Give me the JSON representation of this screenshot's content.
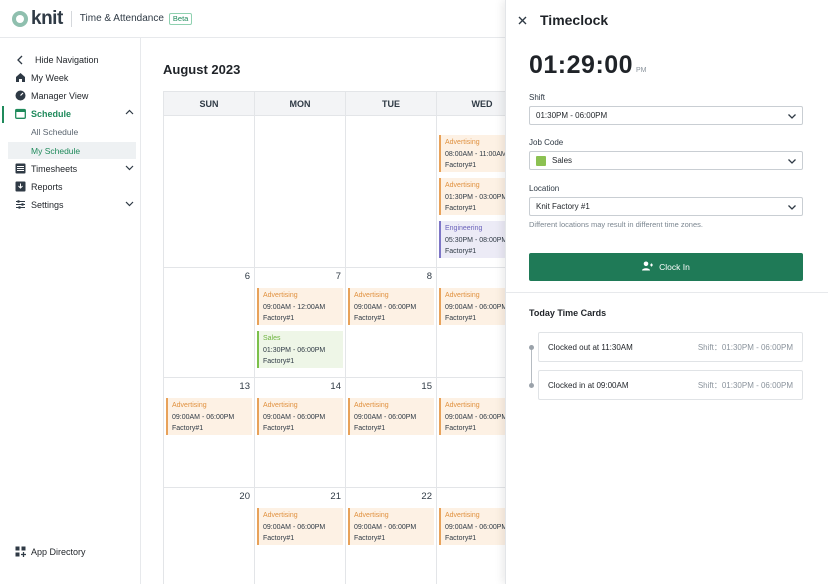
{
  "topbar": {
    "logo_text": "knit",
    "app_name": "Time & Attendance",
    "beta": "Beta"
  },
  "sidebar": {
    "hide_nav": "Hide Navigation",
    "my_week": "My Week",
    "manager_view": "Manager View",
    "schedule": "Schedule",
    "all_schedule": "All Schedule",
    "my_schedule": "My Schedule",
    "timesheets": "Timesheets",
    "reports": "Reports",
    "settings": "Settings",
    "app_directory": "App Directory"
  },
  "calendar": {
    "month": "August 2023",
    "days": [
      "SUN",
      "MON",
      "TUE",
      "WED"
    ],
    "weeks": [
      {
        "nums": [
          "",
          "",
          "",
          ""
        ]
      },
      {
        "nums": [
          "6",
          "7",
          "8",
          ""
        ]
      },
      {
        "nums": [
          "13",
          "14",
          "15",
          ""
        ]
      },
      {
        "nums": [
          "20",
          "21",
          "22",
          ""
        ]
      }
    ],
    "events": {
      "w1_wed_1": {
        "title": "Advertising",
        "time": "08:00AM - 11:00AM",
        "loc": "Factory#1"
      },
      "w1_wed_2": {
        "title": "Advertising",
        "time": "01:30PM - 03:00PM",
        "loc": "Factory#1"
      },
      "w1_wed_3": {
        "title": "Engineering",
        "time": "05:30PM - 08:00PM",
        "loc": "Factory#1"
      },
      "w2_mon_1": {
        "title": "Advertising",
        "time": "09:00AM - 12:00AM",
        "loc": "Factory#1"
      },
      "w2_mon_2": {
        "title": "Sales",
        "time": "01:30PM - 06:00PM",
        "loc": "Factory#1"
      },
      "w2_tue_1": {
        "title": "Advertising",
        "time": "09:00AM - 06:00PM",
        "loc": "Factory#1"
      },
      "w2_wed_1": {
        "title": "Advertising",
        "time": "09:00AM - 06:00PM",
        "loc": "Factory#1"
      },
      "w3_sun_1": {
        "title": "Advertising",
        "time": "09:00AM - 06:00PM",
        "loc": "Factory#1"
      },
      "w3_mon_1": {
        "title": "Advertising",
        "time": "09:00AM - 06:00PM",
        "loc": "Factory#1"
      },
      "w3_tue_1": {
        "title": "Advertising",
        "time": "09:00AM - 06:00PM",
        "loc": "Factory#1"
      },
      "w3_wed_1": {
        "title": "Advertising",
        "time": "09:00AM - 06:00PM",
        "loc": "Factory#1"
      },
      "w4_mon_1": {
        "title": "Advertising",
        "time": "09:00AM - 06:00PM",
        "loc": "Factory#1"
      },
      "w4_tue_1": {
        "title": "Advertising",
        "time": "09:00AM - 06:00PM",
        "loc": "Factory#1"
      },
      "w4_wed_1": {
        "title": "Advertising",
        "time": "09:00AM - 06:00PM",
        "loc": "Factory#1"
      }
    }
  },
  "panel": {
    "title": "Timeclock",
    "time": "01:29:00",
    "ampm": "PM",
    "shift_label": "Shift",
    "shift_value": "01:30PM - 06:00PM",
    "jobcode_label": "Job Code",
    "jobcode_value": "Sales",
    "jobcode_color": "#8cc152",
    "location_label": "Location",
    "location_value": "Knit Factory #1",
    "location_hint": "Different locations may result in different time zones.",
    "clock_in": "Clock In",
    "today_title": "Today Time Cards",
    "cards": [
      {
        "label": "Clocked out at 11:30AM",
        "shift": "Shift：01:30PM - 06:00PM"
      },
      {
        "label": "Clocked in at 09:00AM",
        "shift": "Shift：01:30PM - 06:00PM"
      }
    ]
  },
  "colors": {
    "accent": "#1f7a57",
    "advertising": "#e8a25a",
    "sales": "#7cc04b",
    "engineering": "#7d75c6"
  }
}
